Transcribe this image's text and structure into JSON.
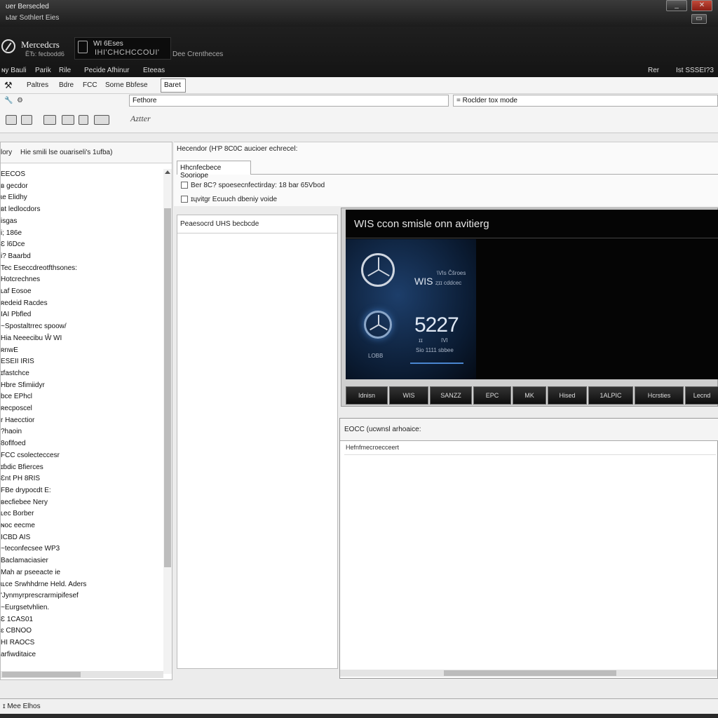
{
  "window": {
    "title_line1": "ʊer Bersecled",
    "title_line2": "ьtar Sothlert Eies",
    "restore_label": "▭"
  },
  "brand": {
    "name": "Mercedcrs",
    "subtitle": "ЁЂ: fecbodd6",
    "product_line1": "WI 6Eses",
    "product_line2": "IHI'CHCHCCOUI'",
    "product_desc": "Dee Crentheces"
  },
  "menu": {
    "items": [
      "ɴy Bauli",
      "Parik",
      "Rile",
      "Pecide Afhinur",
      "Eteeas"
    ],
    "right_items": [
      "Rer",
      "Ist SSSEI?3"
    ]
  },
  "toolbar": {
    "items": [
      "Paltres",
      "Bdre",
      "FCC",
      "Sorne Bbfese"
    ],
    "pressed_label": "Baret",
    "field1_label": "Fethore",
    "field2_label": "= Roclder tox mode",
    "signature": "Aztter"
  },
  "left_pane": {
    "header_left": "lory",
    "header_right": "Hie smili lse ouariseli's 1ufba)",
    "tree": [
      "ЕЕCOS",
      "ʙ gecdor",
      "ɩe Elidhy",
      "ʙt ledlocdors",
      "isgas",
      "i; 186e",
      "Ɛ l6Dce",
      "i? Baarbd",
      "Tec Eseccdreotfthsones:",
      "Hotcrechnes",
      "ʟaf Eosoe",
      "ʀedeid Racdes",
      "IAI Pbfled",
      "~Spostaltrrec spoow/",
      "Hia Neeecibu Ŵ WI",
      "ʀnwE",
      "ESEII IRIS",
      "ɪfastchce",
      "Hbre Sfimiidyr",
      "bce EPhcl",
      "ʀecposcel",
      "r Haecctior",
      "?haoin",
      "8oflfoed",
      "FCC csolecteccesr",
      "ɪɓdic Bfierces",
      "Ɛnt PH 8RIS",
      "FBe drypocdt E:",
      "ʙecfiebee Nery",
      "ʟec Borber",
      "ɴoc eecme",
      "ICBD AIS",
      "~teconfecsee WP3",
      "Baclamaciasier",
      "Mah ar pseeacte ie",
      "ɩʟce Srwhhdrne Held. Aders",
      "'Jynmyrprescrarmipifesef",
      "~Eurgsetvhlien.",
      "Ɛ 1CAS01",
      "ɛ CBNOO",
      "HI RAOCS",
      "arfiwditaice"
    ]
  },
  "right_top": {
    "line1": "Hecendor (H'P 8C0C aucioer echrecel:",
    "tab": "Hhcnfecbece Sooriope",
    "check1": "Ber 8C? spoesecnfectirday: 18 bar 65Vbod",
    "check2": "ɪɥvitgr Ecuuch dbeniy voide"
  },
  "mid_pane": {
    "header": "Peaesocrd UHS becbcde"
  },
  "wis": {
    "title": "WIS ccon smisle onn avitierg",
    "label": "WIS",
    "small1": "\\VIs Ĉŝroes",
    "small2": "ȥɪɪ cddcec",
    "big": "5227",
    "b1": "ɪɪ",
    "b2": "IVI",
    "b3": "Sio 1111 sbbee",
    "b4": "LOBB",
    "buttons": [
      "Idnisn",
      "WIS",
      "SANZZ",
      "EPC",
      "MK",
      "Hised",
      "1ALPIC",
      "Hcrsties",
      "Lecnd"
    ]
  },
  "right_bottom": {
    "header": "EOCC (ucwnsl arhoaice:",
    "subheader": "Hefnfmecroecceert"
  },
  "status": {
    "text": "ɪ Mee Elhos"
  }
}
